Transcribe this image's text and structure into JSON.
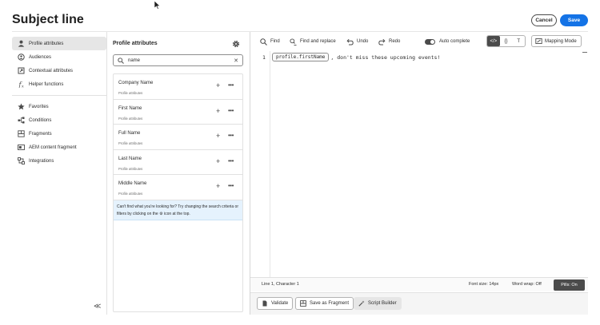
{
  "header": {
    "title": "Subject line",
    "cancel_label": "Cancel",
    "save_label": "Save"
  },
  "nav": {
    "items": [
      {
        "label": "Profile attributes",
        "icon": "person-icon"
      },
      {
        "label": "Audiences",
        "icon": "audience-icon"
      },
      {
        "label": "Contextual attributes",
        "icon": "context-icon"
      },
      {
        "label": "Helper functions",
        "icon": "function-icon"
      }
    ],
    "items2": [
      {
        "label": "Favorites",
        "icon": "star-icon"
      },
      {
        "label": "Conditions",
        "icon": "branch-icon"
      },
      {
        "label": "Fragments",
        "icon": "fragment-icon"
      },
      {
        "label": "AEM content fragment",
        "icon": "aem-icon"
      },
      {
        "label": "Integrations",
        "icon": "integration-icon"
      }
    ],
    "collapse_glyph": "≪"
  },
  "panel": {
    "title": "Profile attributes",
    "search_value": "name",
    "results": [
      {
        "name": "Company Name",
        "sub": "Profile attributes"
      },
      {
        "name": "First Name",
        "sub": "Profile attributes"
      },
      {
        "name": "Full Name",
        "sub": "Profile attributes"
      },
      {
        "name": "Last Name",
        "sub": "Profile attributes"
      },
      {
        "name": "Middle Name",
        "sub": "Profile attributes"
      }
    ],
    "hint_part1": "Can't find what you're looking for? Try changing the search criteria or filters by clicking on the",
    "hint_part2": "icon at the top."
  },
  "toolbar": {
    "find": "Find",
    "find_replace": "Find and replace",
    "undo": "Undo",
    "redo": "Redo",
    "auto_complete": "Auto complete",
    "mapping_mode": "Mapping Mode"
  },
  "editor": {
    "line_number": "1",
    "pill": "profile.firstName",
    "text": ", don't miss these upcoming events!"
  },
  "status": {
    "position": "Line 1, Character 1",
    "font_size": "Font size: 14px",
    "word_wrap": "Word wrap: Off",
    "pills": "Pills: On"
  },
  "actions": {
    "validate": "Validate",
    "save_fragment": "Save as Fragment",
    "script_builder": "Script Builder"
  },
  "colors": {
    "accent": "#1473e6",
    "hint_bg": "#e5f2fd"
  }
}
